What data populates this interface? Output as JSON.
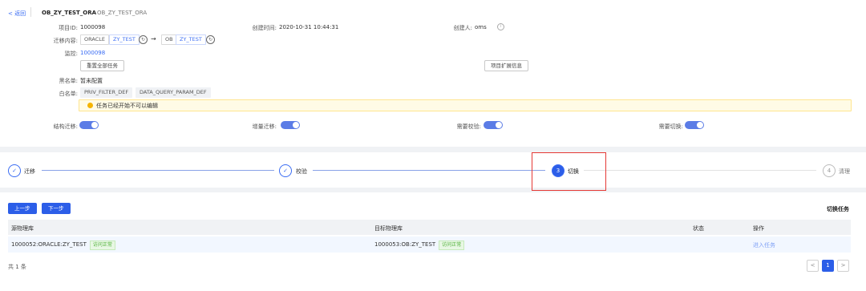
{
  "header": {
    "back_label": "< 返回",
    "project_name": "OB_ZY_TEST_ORA",
    "project_sub": "OB_ZY_TEST_ORA"
  },
  "info": {
    "id_label": "项目ID:",
    "id_value": "1000098",
    "created_label": "创建时间:",
    "created_value": "2020-10-31 10:44:31",
    "creator_label": "创建人:",
    "creator_value": "oms",
    "migration_label": "迁移内容:",
    "src_type": "ORACLE",
    "src_db": "ZY_TEST",
    "arrow": "→",
    "dst_type": "OB",
    "dst_db": "ZY_TEST",
    "monitor_label": "监控:",
    "monitor_value": "1000098",
    "reset_button": "重置全部任务",
    "ext_info_button": "项目扩展信息",
    "blacklist_label": "黑名单:",
    "blacklist_value": "暂未配置",
    "whitelist_label": "白名单:",
    "whitelist_items": [
      "PRIV_FILTER_DEF",
      "DATA_QUERY_PARAM_DEF"
    ],
    "warning_text": "任务已经开始不可以编辑"
  },
  "toggles": {
    "structure_label": "结构迁移:",
    "incremental_label": "增量迁移:",
    "verify_label": "需要校验:",
    "switch_label": "需要切换:"
  },
  "steps": [
    {
      "label": "迁移",
      "marker": "✓"
    },
    {
      "label": "校验",
      "marker": "✓"
    },
    {
      "label": "切换",
      "marker": "3"
    },
    {
      "label": "清理",
      "marker": "4"
    }
  ],
  "actions": {
    "prev_button": "上一步",
    "next_button": "下一步",
    "section_title": "切换任务"
  },
  "table": {
    "headers": [
      "源物理库",
      "目标物理库",
      "状态",
      "操作"
    ],
    "rows": [
      {
        "source": "1000052:ORACLE:ZY_TEST",
        "source_badge": "访问正常",
        "target": "1000053:OB:ZY_TEST",
        "target_badge": "访问正常",
        "status": "",
        "action": "进入任务"
      }
    ],
    "total": "共 1 条"
  },
  "pagination": {
    "prev": "<",
    "current": "1",
    "next": ">"
  },
  "colors": {
    "primary": "#2c5ee8",
    "highlight_box": "#e53935",
    "warning_dot": "#f5b400",
    "ok_badge": "#52b33b"
  }
}
